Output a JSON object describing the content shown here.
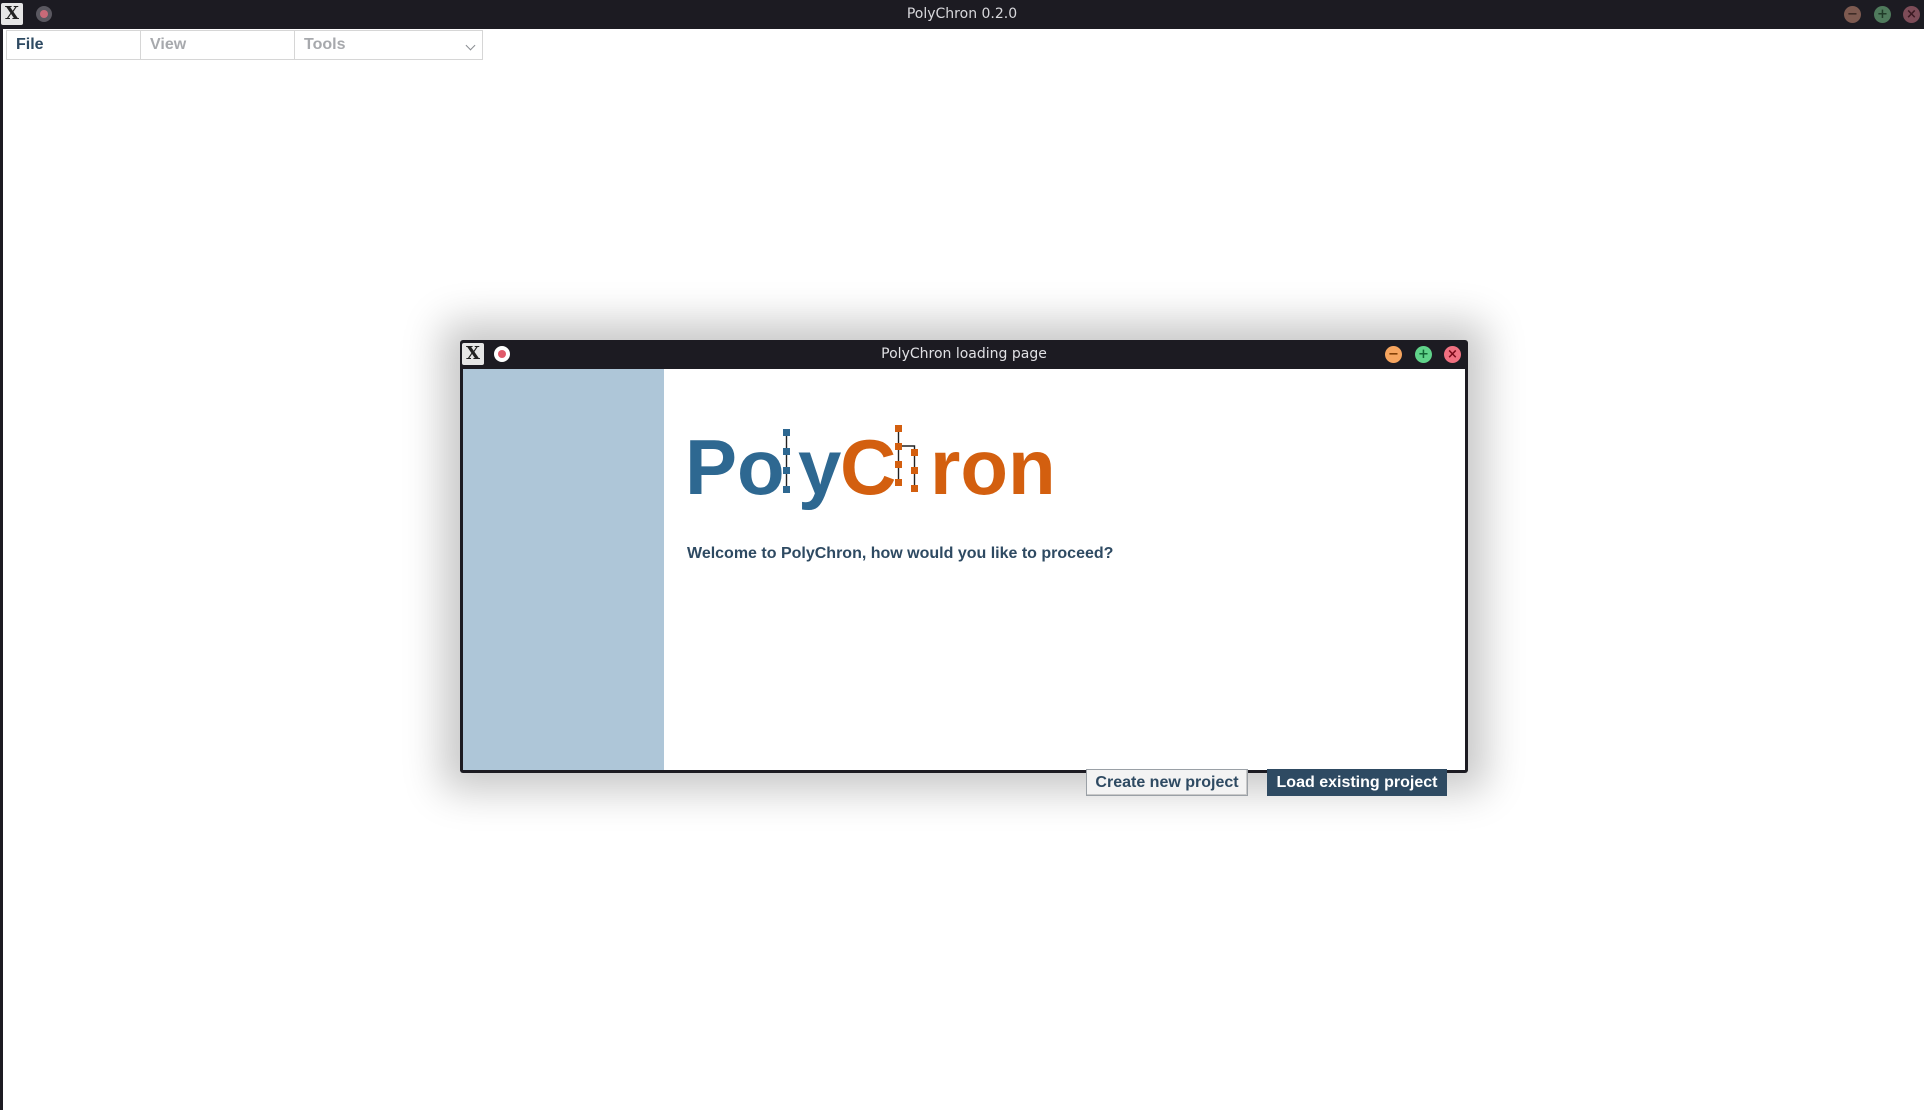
{
  "main_window": {
    "title": "PolyChron 0.2.0"
  },
  "menu": {
    "file": "File",
    "view": "View",
    "tools": "Tools"
  },
  "dialog": {
    "title": "PolyChron loading page",
    "logo_text": "PolyChron",
    "welcome": "Welcome to PolyChron, how would you like to proceed?",
    "create_button": "Create new project",
    "load_button": "Load existing project"
  },
  "colors": {
    "logo_blue": "#2e6891",
    "logo_orange": "#d35f0f",
    "text_navy": "#2e4a62",
    "side_panel": "#aec6d8",
    "titlebar": "#1c1b22"
  },
  "icons": {
    "app": "x-app-icon",
    "pin": "pin-icon",
    "minimize": "minimize-icon",
    "maximize": "maximize-icon",
    "close": "close-icon",
    "dropdown": "chevron-down-icon"
  }
}
